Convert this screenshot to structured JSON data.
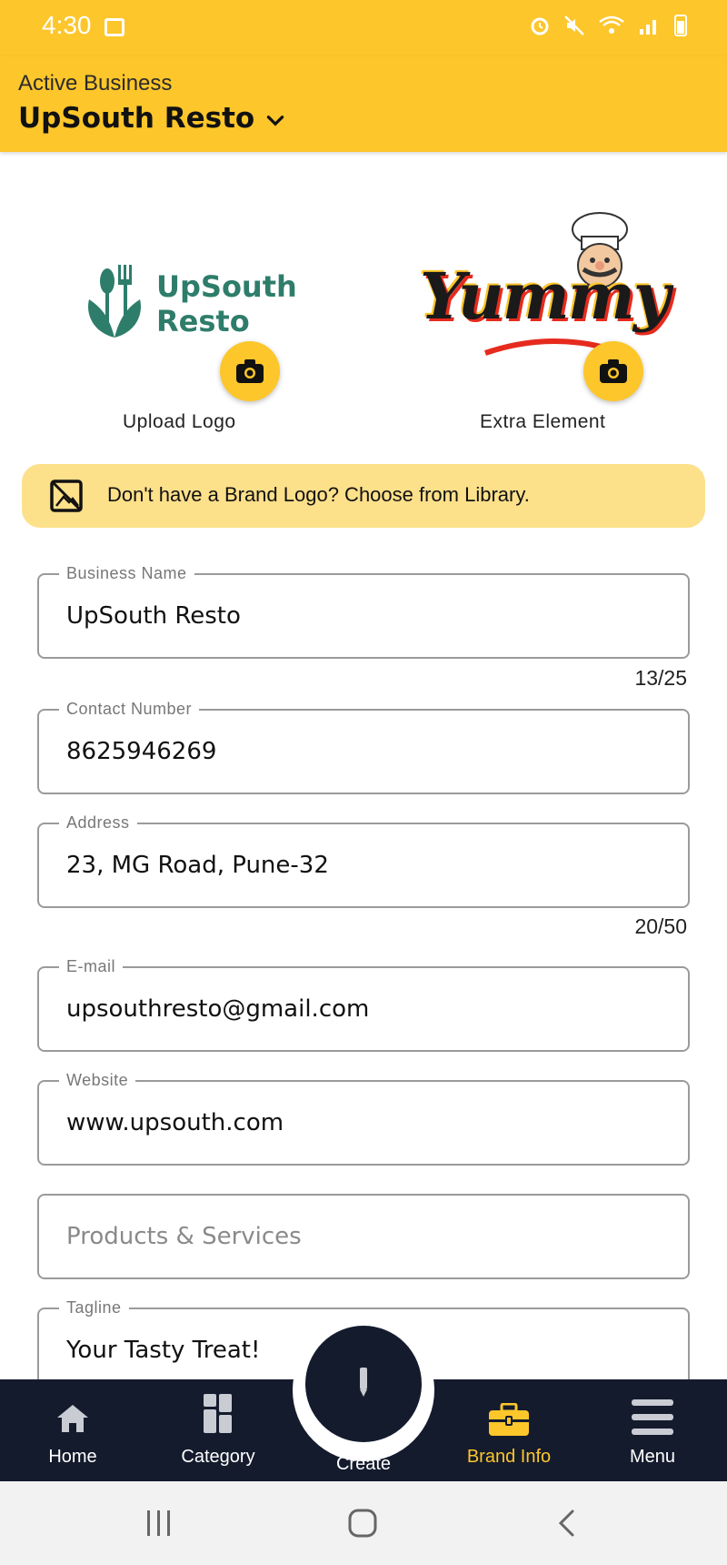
{
  "status_bar": {
    "time": "4:30"
  },
  "header": {
    "subtitle": "Active Business",
    "business": "UpSouth Resto"
  },
  "logos": {
    "upload_caption": "Upload Logo",
    "extra_caption": "Extra Element",
    "left_logo_line1": "UpSouth",
    "left_logo_line2": "Resto",
    "right_logo_text": "Yummy"
  },
  "library_banner": {
    "text": "Don't have a Brand Logo? Choose from Library."
  },
  "form": {
    "business_name": {
      "label": "Business Name",
      "value": "UpSouth Resto",
      "counter": "13/25"
    },
    "contact": {
      "label": "Contact Number",
      "value": "8625946269"
    },
    "address": {
      "label": "Address",
      "value": "23, MG Road, Pune-32",
      "counter": "20/50"
    },
    "email": {
      "label": "E-mail",
      "value": "upsouthresto@gmail.com"
    },
    "website": {
      "label": "Website",
      "value": "www.upsouth.com"
    },
    "products": {
      "placeholder": "Products & Services"
    },
    "tagline": {
      "label": "Tagline",
      "value": "Your Tasty Treat!"
    }
  },
  "bottom_nav": {
    "home": "Home",
    "category": "Category",
    "create": "Create",
    "brand_info": "Brand Info",
    "menu": "Menu",
    "active": "brand_info"
  },
  "colors": {
    "accent": "#FDC62B",
    "nav_bg": "#141b2d",
    "logo_green": "#2e7d6b"
  }
}
